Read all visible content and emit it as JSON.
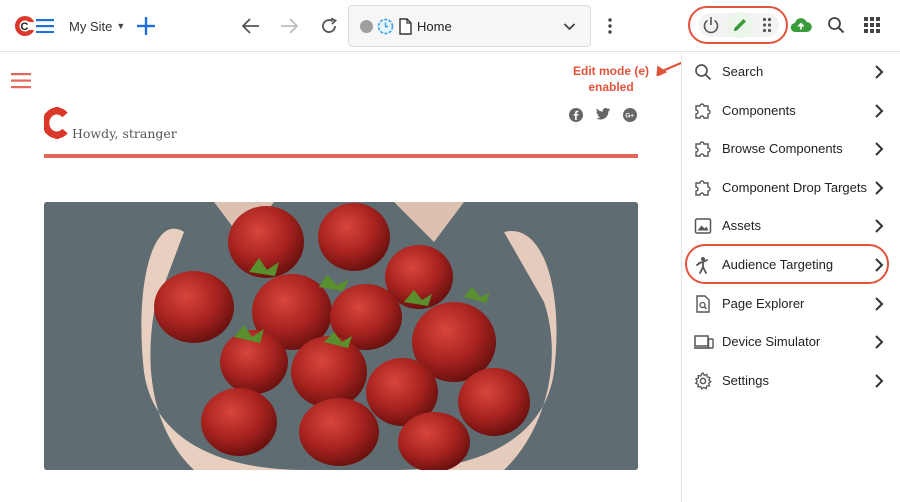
{
  "toolbar": {
    "site_name": "My Site",
    "address": {
      "page_title": "Home"
    }
  },
  "site": {
    "greeting": "Howdy, stranger"
  },
  "annotation": {
    "edit_mode_line1": "Edit mode (e)",
    "edit_mode_line2": "enabled",
    "accent_color": "#e2533c"
  },
  "panel": {
    "items": [
      {
        "label": "Search",
        "icon": "search-icon"
      },
      {
        "label": "Components",
        "icon": "puzzle-icon"
      },
      {
        "label": "Browse Components",
        "icon": "puzzle-icon"
      },
      {
        "label": "Component Drop Targets",
        "icon": "puzzle-icon"
      },
      {
        "label": "Assets",
        "icon": "image-icon"
      },
      {
        "label": "Audience Targeting",
        "icon": "person-icon"
      },
      {
        "label": "Page Explorer",
        "icon": "document-search-icon"
      },
      {
        "label": "Device Simulator",
        "icon": "devices-icon"
      },
      {
        "label": "Settings",
        "icon": "gear-icon"
      }
    ]
  },
  "colors": {
    "brand_red": "#e2533c",
    "edit_green": "#3a9b3a",
    "link_blue": "#1e6fd9"
  }
}
